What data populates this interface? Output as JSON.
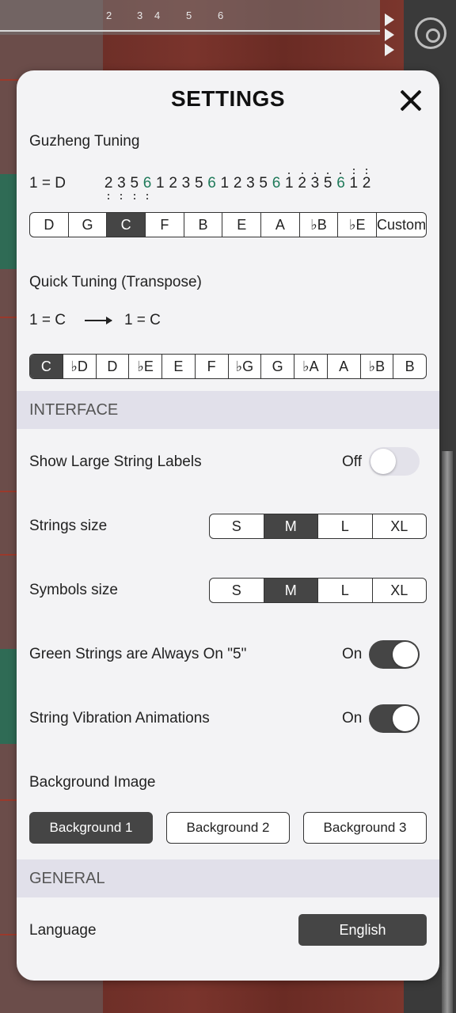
{
  "background": {
    "ruler_numbers": [
      "2",
      "3",
      "4",
      "5",
      "6"
    ]
  },
  "modal": {
    "title": "SETTINGS",
    "guzheng_tuning": {
      "label": "Guzheng Tuning",
      "key": "1 = D",
      "notes": [
        {
          "n": "2",
          "dots": "below1"
        },
        {
          "n": "3",
          "dots": "below1"
        },
        {
          "n": "5",
          "dots": "below1"
        },
        {
          "n": "6",
          "dots": "below1",
          "green": true
        },
        {
          "n": "1",
          "dots": ""
        },
        {
          "n": "2",
          "dots": ""
        },
        {
          "n": "3",
          "dots": ""
        },
        {
          "n": "5",
          "dots": ""
        },
        {
          "n": "6",
          "dots": "",
          "green": true
        },
        {
          "n": "1",
          "dots": ""
        },
        {
          "n": "2",
          "dots": ""
        },
        {
          "n": "3",
          "dots": ""
        },
        {
          "n": "5",
          "dots": ""
        },
        {
          "n": "6",
          "dots": "",
          "green": true
        },
        {
          "n": "1",
          "dots": "above1"
        },
        {
          "n": "2",
          "dots": "above1"
        },
        {
          "n": "3",
          "dots": "above1"
        },
        {
          "n": "5",
          "dots": "above1"
        },
        {
          "n": "6",
          "dots": "above1",
          "green": true
        },
        {
          "n": "1",
          "dots": "above2"
        },
        {
          "n": "2",
          "dots": "above2"
        }
      ],
      "options": [
        "D",
        "G",
        "C",
        "F",
        "B",
        "E",
        "A",
        "♭B",
        "♭E",
        "Custom"
      ],
      "selected": "C"
    },
    "quick_tuning": {
      "label": "Quick Tuning (Transpose)",
      "from": "1 = C",
      "to": "1 = C",
      "options": [
        "C",
        "♭D",
        "D",
        "♭E",
        "E",
        "F",
        "♭G",
        "G",
        "♭A",
        "A",
        "♭B",
        "B"
      ],
      "selected": "C"
    },
    "interface": {
      "section_title": "INTERFACE",
      "large_labels": {
        "label": "Show Large String Labels",
        "state": "Off"
      },
      "strings_size": {
        "label": "Strings size",
        "options": [
          "S",
          "M",
          "L",
          "XL"
        ],
        "selected": "M"
      },
      "symbols_size": {
        "label": "Symbols size",
        "options": [
          "S",
          "M",
          "L",
          "XL"
        ],
        "selected": "M"
      },
      "green_strings": {
        "label": "Green Strings are  Always On \"5\"",
        "state": "On"
      },
      "vibration": {
        "label": "String Vibration Animations",
        "state": "On"
      },
      "background_image": {
        "label": "Background Image",
        "options": [
          "Background 1",
          "Background 2",
          "Background 3"
        ],
        "selected": "Background 1"
      }
    },
    "general": {
      "section_title": "GENERAL",
      "language": {
        "label": "Language",
        "value": "English"
      }
    }
  }
}
